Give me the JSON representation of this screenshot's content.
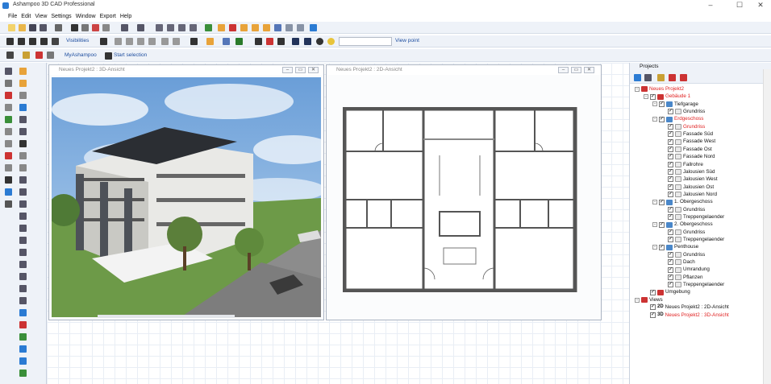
{
  "window": {
    "title": "Ashampoo 3D CAD Professional"
  },
  "menu": [
    "File",
    "Edit",
    "View",
    "Settings",
    "Window",
    "Export",
    "Help"
  ],
  "toolbar2": {
    "visibilities_label": "Visibilities",
    "view_point_label": "View point",
    "view_point_value": ""
  },
  "toolbar3": {
    "myashampoo_label": "MyAshampoo",
    "start_selection_label": "Start selection"
  },
  "view3d": {
    "title": "Neues Projekt2 : 3D-Ansicht"
  },
  "view2d": {
    "title": "Neues Projekt2 : 2D-Ansicht"
  },
  "projects": {
    "title": "Projects",
    "tree": [
      {
        "label": "Neues Projekt2",
        "level": 0,
        "red": true,
        "check": false,
        "expand": "-"
      },
      {
        "label": "Gebäude 1",
        "level": 1,
        "red": true,
        "check": true,
        "expand": "-"
      },
      {
        "label": "Tiefgarage",
        "level": 2,
        "red": false,
        "check": true,
        "expand": "-"
      },
      {
        "label": "Grundriss",
        "level": 3,
        "red": false,
        "check": true,
        "expand": ""
      },
      {
        "label": "Erdgeschoss",
        "level": 2,
        "red": true,
        "check": true,
        "expand": "-"
      },
      {
        "label": "Grundriss",
        "level": 3,
        "red": true,
        "check": true,
        "expand": ""
      },
      {
        "label": "Fassade Süd",
        "level": 3,
        "red": false,
        "check": true,
        "expand": ""
      },
      {
        "label": "Fassade West",
        "level": 3,
        "red": false,
        "check": true,
        "expand": ""
      },
      {
        "label": "Fassade Ost",
        "level": 3,
        "red": false,
        "check": true,
        "expand": ""
      },
      {
        "label": "Fassade Nord",
        "level": 3,
        "red": false,
        "check": true,
        "expand": ""
      },
      {
        "label": "Fallrohre",
        "level": 3,
        "red": false,
        "check": true,
        "expand": ""
      },
      {
        "label": "Jalousien Süd",
        "level": 3,
        "red": false,
        "check": true,
        "expand": ""
      },
      {
        "label": "Jalousien West",
        "level": 3,
        "red": false,
        "check": true,
        "expand": ""
      },
      {
        "label": "Jalousien Ost",
        "level": 3,
        "red": false,
        "check": true,
        "expand": ""
      },
      {
        "label": "Jalousien Nord",
        "level": 3,
        "red": false,
        "check": true,
        "expand": ""
      },
      {
        "label": "1. Obergeschoss",
        "level": 2,
        "red": false,
        "check": true,
        "expand": "-"
      },
      {
        "label": "Grundriss",
        "level": 3,
        "red": false,
        "check": true,
        "expand": ""
      },
      {
        "label": "Treppengelaender",
        "level": 3,
        "red": false,
        "check": true,
        "expand": ""
      },
      {
        "label": "2. Obergeschoss",
        "level": 2,
        "red": false,
        "check": true,
        "expand": "-"
      },
      {
        "label": "Grundriss",
        "level": 3,
        "red": false,
        "check": true,
        "expand": ""
      },
      {
        "label": "Treppengelaender",
        "level": 3,
        "red": false,
        "check": true,
        "expand": ""
      },
      {
        "label": "Penthouse",
        "level": 2,
        "red": false,
        "check": true,
        "expand": "-"
      },
      {
        "label": "Grundriss",
        "level": 3,
        "red": false,
        "check": true,
        "expand": ""
      },
      {
        "label": "Dach",
        "level": 3,
        "red": false,
        "check": true,
        "expand": ""
      },
      {
        "label": "Umrandung",
        "level": 3,
        "red": false,
        "check": true,
        "expand": ""
      },
      {
        "label": "Pflanzen",
        "level": 3,
        "red": false,
        "check": true,
        "expand": ""
      },
      {
        "label": "Treppengelaender",
        "level": 3,
        "red": false,
        "check": true,
        "expand": ""
      },
      {
        "label": "Umgebung",
        "level": 1,
        "red": false,
        "check": true,
        "expand": ""
      },
      {
        "label": "Views",
        "level": 0,
        "red": false,
        "check": false,
        "expand": "-"
      },
      {
        "label": "Neues Projekt2 : 2D-Ansicht",
        "level": 1,
        "red": false,
        "check": true,
        "expand": "",
        "tag": "2D"
      },
      {
        "label": "Neues Projekt2 : 3D-Ansicht",
        "level": 1,
        "red": true,
        "check": true,
        "expand": "",
        "tag": "3D"
      }
    ]
  },
  "colors": {
    "accent": "#2b7bd3",
    "tree_red": "#e02020",
    "toolbar_bg": "#eef2f8"
  }
}
